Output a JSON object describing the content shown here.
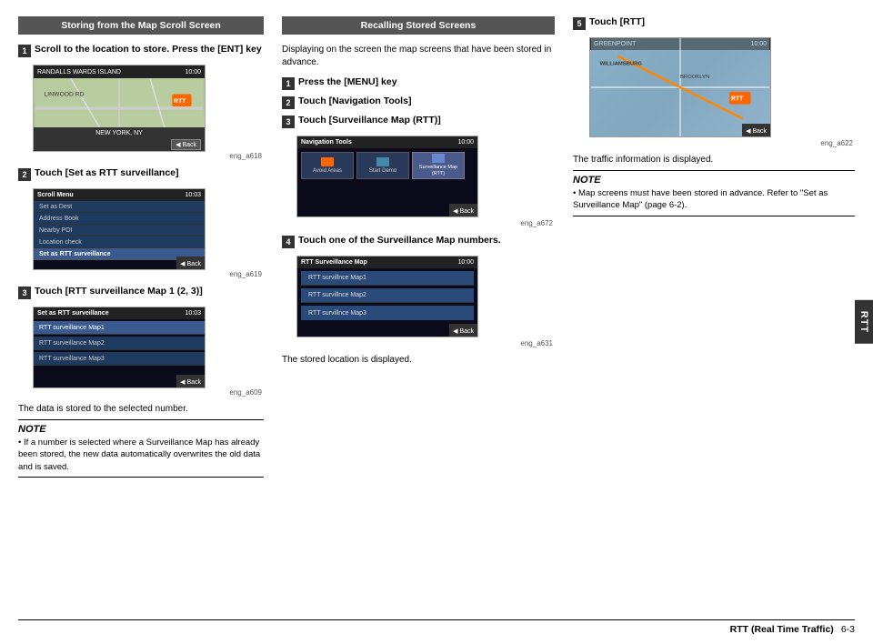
{
  "page": {
    "title": "RTT (Real Time Traffic)",
    "page_num": "6-3"
  },
  "left_section": {
    "header": "Storing from the Map Scroll Screen",
    "step1": {
      "number": "1",
      "text": "Scroll to the location to store. Press the [ENT] key",
      "image_caption": "eng_a618"
    },
    "step2": {
      "number": "2",
      "text": "Touch [Set as RTT surveillance]",
      "image_caption": "eng_a619"
    },
    "step3": {
      "number": "3",
      "text": "Touch [RTT surveillance Map 1 (2, 3)]",
      "image_caption": "eng_a609"
    },
    "data_stored_text": "The data is stored to the selected number.",
    "note_title": "NOTE",
    "note_bullets": [
      "If a number is selected where a Surveillance Map has already been stored, the new data automatically overwrites the old data and is saved."
    ]
  },
  "middle_section": {
    "header": "Recalling Stored Screens",
    "intro_text": "Displaying on the screen the map screens that have been stored in advance.",
    "step1": {
      "number": "1",
      "text": "Press the [MENU] key"
    },
    "step2": {
      "number": "2",
      "text": "Touch [Navigation Tools]"
    },
    "step3": {
      "number": "3",
      "text": "Touch [Surveillance Map (RTT)]",
      "image_caption": "eng_a672"
    },
    "step4": {
      "number": "4",
      "text": "Touch one of the Surveillance Map numbers.",
      "image_caption": "eng_a631"
    },
    "stored_location_text": "The stored location is displayed."
  },
  "right_section": {
    "step5": {
      "number": "5",
      "text": "Touch [RTT]",
      "image_caption": "eng_a622"
    },
    "traffic_info_text": "The traffic information is displayed.",
    "note_title": "NOTE",
    "note_bullets": [
      "Map screens must have been stored in advance. Refer to \"Set as Surveillance Map\" (page 6-2)."
    ]
  },
  "sidebar": {
    "label": "RTT"
  },
  "menu_items": {
    "scroll_menu_title": "Scroll Menu",
    "items": [
      "Set as Dest",
      "Address Book",
      "Nearby POI",
      "Location check",
      "Set as RTT surveillance"
    ]
  },
  "rtt_map_items": {
    "title": "Set as RTT surveillance",
    "items": [
      "RTT surveillance Map1",
      "RTT surveillance Map2",
      "RTT surveillance Map3"
    ]
  },
  "nav_tools": {
    "items": [
      "Avoid Areas",
      "Start Demo",
      "Surveillance Map (RTT)"
    ]
  },
  "rtt_surveillance": {
    "title": "RTT Surveillance Map",
    "items": [
      "RTT survillnce Map1",
      "RTT survillnce Map2",
      "RTT survillnce Map3"
    ]
  },
  "map_labels": {
    "location1": "RANDALLS WARDS ISLAND",
    "location2": "NEW YORK, NY",
    "time1": "10:00",
    "route_num": "RTT",
    "back_btn": "Back"
  }
}
